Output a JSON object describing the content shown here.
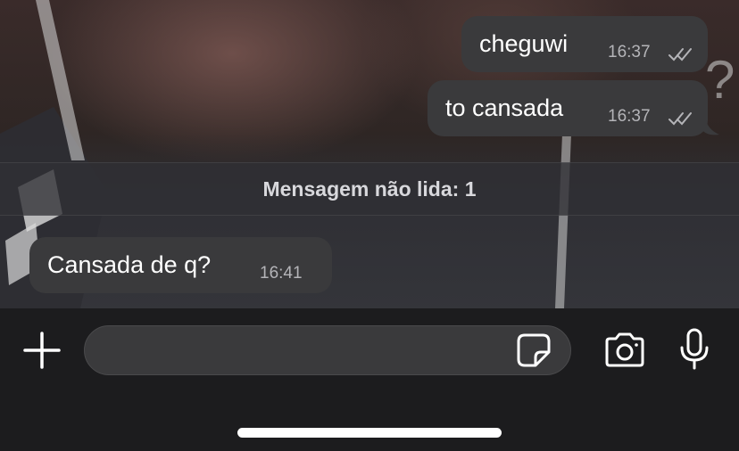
{
  "messages": [
    {
      "direction": "outgoing",
      "text": "cheguwi",
      "time": "16:37",
      "status": "read"
    },
    {
      "direction": "outgoing",
      "text": "to cansada",
      "time": "16:37",
      "status": "read"
    },
    {
      "direction": "incoming",
      "text": "Cansada de q?",
      "time": "16:41"
    }
  ],
  "unread_banner": "Mensagem não lida: 1",
  "composer": {
    "placeholder": "",
    "icons": [
      "plus-icon",
      "sticker-icon",
      "camera-icon",
      "microphone-icon"
    ]
  },
  "colors": {
    "bubble": "#3a3a3c",
    "bottom_bar": "#1c1c1e",
    "time_text": "#b4b4b8",
    "read_ticks": "#b4b4b8"
  }
}
